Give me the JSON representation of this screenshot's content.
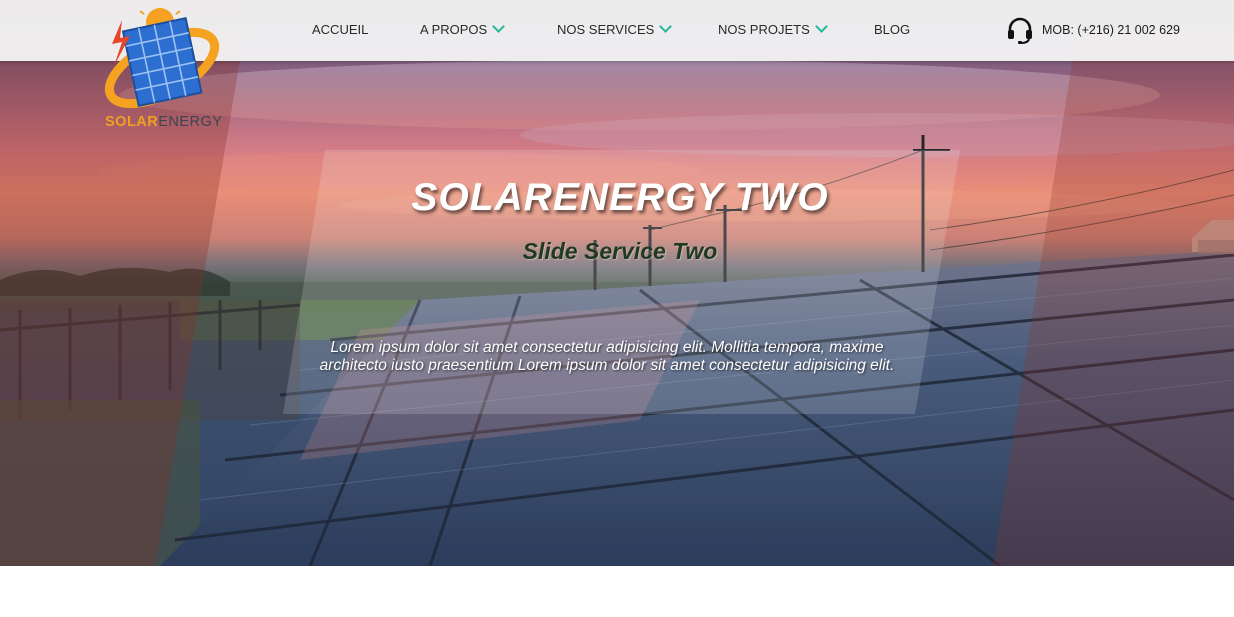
{
  "brand": {
    "logo_part1": "SOLAR",
    "logo_part2": "ENERGY",
    "colors": {
      "accent": "#f0a020",
      "nav_chevron": "#26b89a",
      "panel_blue": "#2f6fd0"
    }
  },
  "nav": {
    "items": [
      {
        "label": "ACCUEIL",
        "has_dropdown": false
      },
      {
        "label": "A PROPOS",
        "has_dropdown": true
      },
      {
        "label": "NOS SERVICES",
        "has_dropdown": true
      },
      {
        "label": "NOS PROJETS",
        "has_dropdown": true
      },
      {
        "label": "BLOG",
        "has_dropdown": false
      }
    ],
    "contact": {
      "icon": "headset-icon",
      "text": "MOB: (+216) 21 002 629"
    }
  },
  "slide": {
    "title": "SOLARENERGY TWO",
    "subtitle": "Slide Service Two",
    "body": "Lorem ipsum dolor sit amet consectetur adipisicing elit. Mollitia tempora, maxime architecto iusto praesentium Lorem ipsum dolor sit amet consectetur adipisicing elit."
  }
}
